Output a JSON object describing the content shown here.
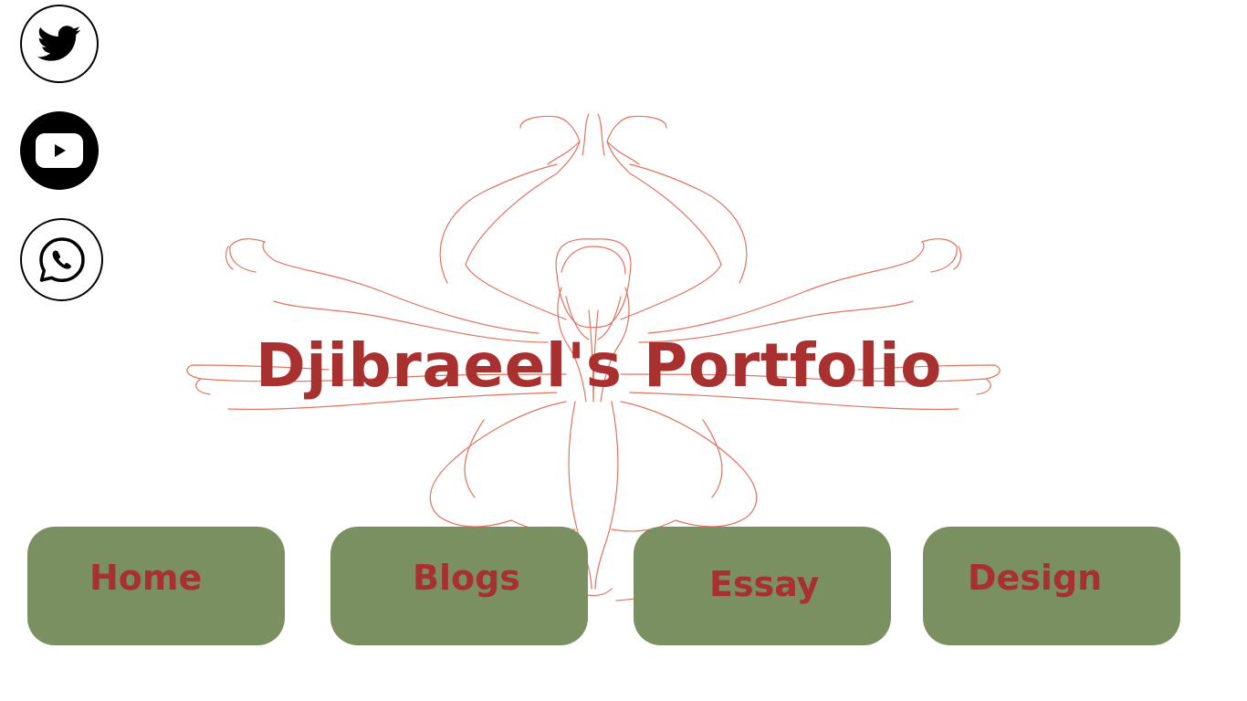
{
  "page": {
    "title": "Djibraeel's Portfolio",
    "accent_color": "#a8302f",
    "button_color": "#7a9061",
    "illustration_color": "#e0745f"
  },
  "social": [
    {
      "icon": "twitter-icon"
    },
    {
      "icon": "youtube-icon"
    },
    {
      "icon": "whatsapp-icon"
    }
  ],
  "nav": {
    "home_label": "Home",
    "blogs_label": "Blogs",
    "essay_label": "Essay",
    "design_label": "Design"
  }
}
